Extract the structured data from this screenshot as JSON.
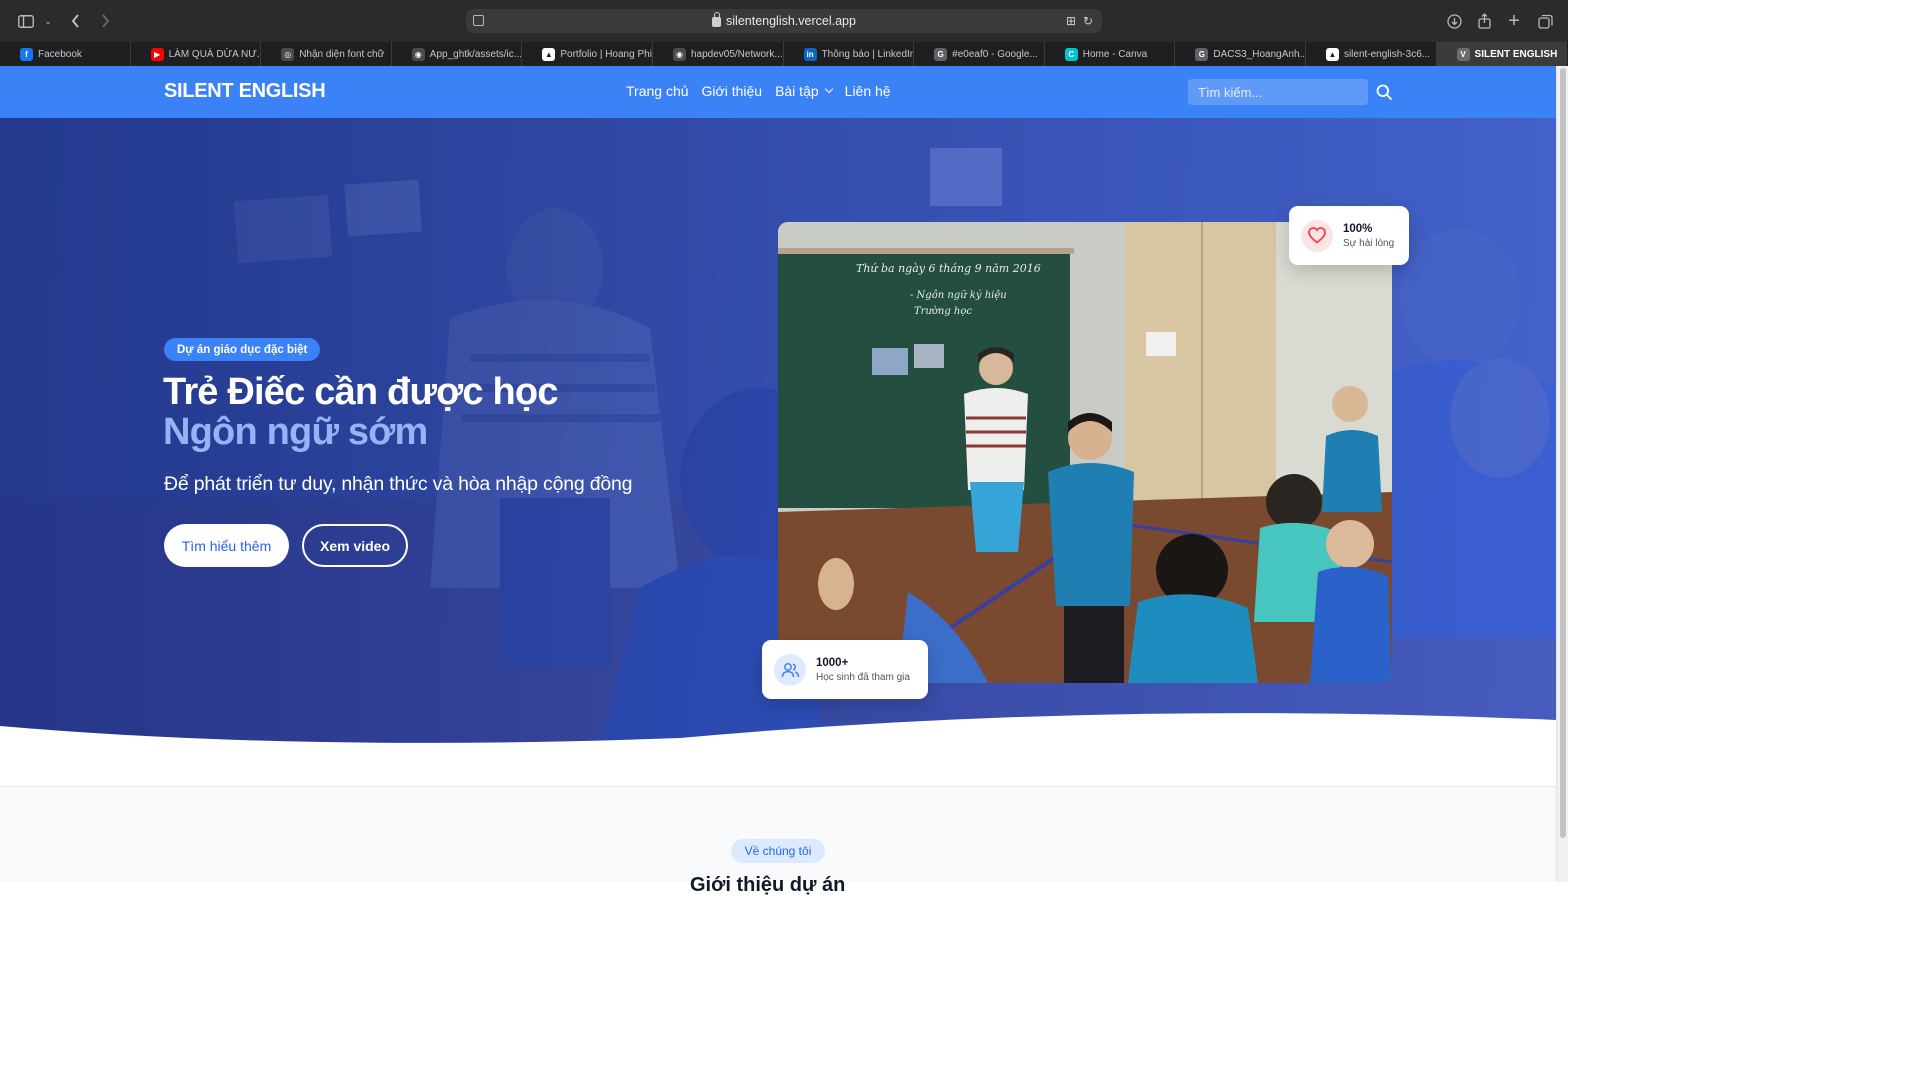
{
  "browser": {
    "url": "silentenglish.vercel.app",
    "tabs": [
      {
        "label": "Facebook",
        "favicon_color": "#1877f2",
        "favicon_glyph": "f"
      },
      {
        "label": "LÀM QUÀ DỪA NƯ...",
        "favicon_color": "#ff0000",
        "favicon_glyph": "▶"
      },
      {
        "label": "Nhận diện font chữ",
        "favicon_color": "#4b4b4e",
        "favicon_glyph": "◎"
      },
      {
        "label": "App_ghtk/assets/ic...",
        "favicon_color": "#4b4b4e",
        "favicon_glyph": "◉"
      },
      {
        "label": "Portfolio | Hoang Phi",
        "favicon_color": "#ffffff",
        "favicon_glyph": "▲"
      },
      {
        "label": "hapdev05/Network...",
        "favicon_color": "#4b4b4e",
        "favicon_glyph": "◉"
      },
      {
        "label": "Thông báo | LinkedIn",
        "favicon_color": "#0a66c2",
        "favicon_glyph": "in"
      },
      {
        "label": "#e0eaf0 - Google...",
        "favicon_color": "#5f6368",
        "favicon_glyph": "G"
      },
      {
        "label": "Home - Canva",
        "favicon_color": "#00c4cc",
        "favicon_glyph": "C"
      },
      {
        "label": "DACS3_HoangAnh...",
        "favicon_color": "#5f6368",
        "favicon_glyph": "G"
      },
      {
        "label": "silent-english-3c6...",
        "favicon_color": "#ffffff",
        "favicon_glyph": "▲"
      },
      {
        "label": "SILENT ENGLISH",
        "favicon_color": "#6b6b6e",
        "favicon_glyph": "V",
        "active": true
      }
    ]
  },
  "nav": {
    "logo": "SILENT ENGLISH",
    "links": [
      "Trang chủ",
      "Giới thiệu",
      "Bài tập",
      "Liên hệ"
    ],
    "search_placeholder": "Tìm kiếm..."
  },
  "hero": {
    "badge": "Dự án giáo dục đặc biệt",
    "title_line1": "Trẻ Điếc cần được học",
    "title_line2": "Ngôn ngữ sớm",
    "subtitle": "Để phát triển tư duy, nhận thức và hòa nhập cộng đồng",
    "primary_button": "Tìm hiểu thêm",
    "secondary_button": "Xem video",
    "stat_satisfaction": {
      "value": "100%",
      "label": "Sự hài lòng"
    },
    "stat_students": {
      "value": "1000+",
      "label": "Học sinh đã tham gia"
    }
  },
  "about": {
    "pill": "Về chúng tôi",
    "title": "Giới thiệu dự án"
  },
  "colors": {
    "primary": "#3b82f6",
    "accent_text": "#93b4f5",
    "heart": "#ef4444"
  }
}
